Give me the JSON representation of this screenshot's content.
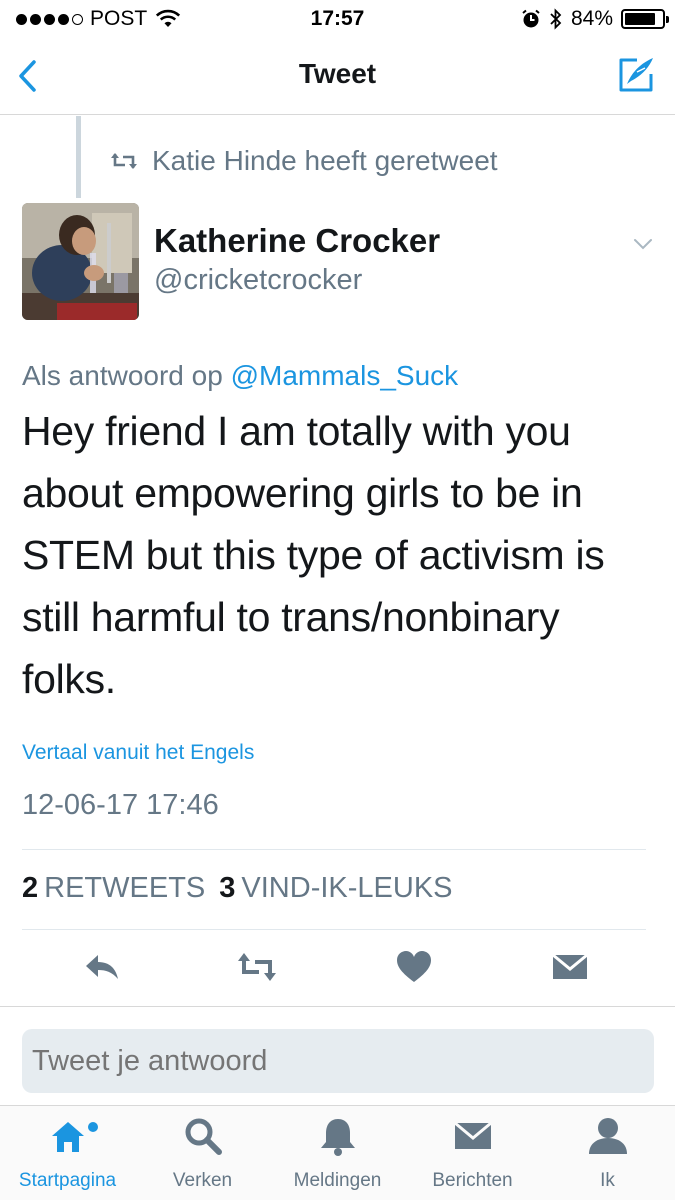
{
  "status_bar": {
    "carrier": "POST",
    "time": "17:57",
    "battery": "84%",
    "battery_level": 0.84
  },
  "nav": {
    "title": "Tweet",
    "back_icon": "chevron-left-icon",
    "compose_icon": "compose-icon"
  },
  "tweet": {
    "retweet_context": "Katie Hinde heeft geretweet",
    "author_name": "Katherine Crocker",
    "author_handle": "@cricketcrocker",
    "reply_prefix": "Als antwoord op",
    "reply_mention": "@Mammals_Suck",
    "text": "Hey friend I am totally with you about empowering girls to be in STEM but this type of activism is still harmful to trans/nonbinary folks.",
    "translate_label": "Vertaal vanuit het Engels",
    "timestamp": "12-06-17 17:46",
    "retweet_count": "2",
    "retweet_label": "RETWEETS",
    "like_count": "3",
    "like_label": "VIND-IK-LEUKS"
  },
  "reply": {
    "placeholder": "Tweet je antwoord"
  },
  "colors": {
    "accent": "#1b95e0",
    "muted": "#657786",
    "text": "#14171a"
  },
  "tabs": [
    {
      "label": "Startpagina",
      "icon": "home-icon",
      "active": true
    },
    {
      "label": "Verken",
      "icon": "search-icon",
      "active": false
    },
    {
      "label": "Meldingen",
      "icon": "bell-icon",
      "active": false
    },
    {
      "label": "Berichten",
      "icon": "envelope-icon",
      "active": false
    },
    {
      "label": "Ik",
      "icon": "person-icon",
      "active": false
    }
  ]
}
